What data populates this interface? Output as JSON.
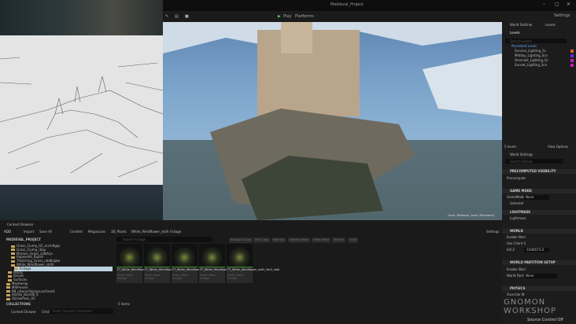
{
  "window": {
    "title": "Medieval_Project",
    "min": "–",
    "max": "□",
    "close": "✕"
  },
  "toolbar": {
    "play": "Play",
    "platforms": "Platforms",
    "settings": "Settings"
  },
  "viewport": {
    "overlay_text": "Level: Medieval_Level (Persistent)"
  },
  "outliner": {
    "tabs": [
      "World Outliner",
      "Levels"
    ],
    "levels_button": "Levels",
    "search_placeholder": "Search Levels",
    "levels": [
      {
        "name": "Persistent Level",
        "color": ""
      },
      {
        "name": "Sunrise_Lighting_Sc",
        "color": "#e06020"
      },
      {
        "name": "Midday_Lighting_Sce",
        "color": "#6a2ae0"
      },
      {
        "name": "Overcast_Lighting_Sc",
        "color": "#c020c0"
      },
      {
        "name": "Sunset_Lighting_Sce",
        "color": "#c020c0"
      }
    ],
    "count": "5 levels",
    "view_options": "View Options"
  },
  "details": {
    "tab": "World Settings",
    "search_placeholder": "Search Details",
    "sections": {
      "precomputed": "PRECOMPUTED VISIBILITY",
      "precompute": "Precompute",
      "game_mode": "GAME MODE",
      "gamemode_label": "GameMode",
      "gamemode_value": "None",
      "selected": "Selected",
      "lightmass": "LIGHTMASS",
      "lightmass_item": "Lightmass",
      "world": "WORLD",
      "enable_world": "Enable Worl",
      "use_client": "Use Client S",
      "kill_z": "Kill Z",
      "kill_z_value": "-1048575.0",
      "partition": "WORLD PARTITION SETUP",
      "enable_wp": "Enable Worl",
      "world_partition": "World Partiti",
      "wp_value": "None",
      "physics": "PHYSICS",
      "override": "Override W"
    },
    "source_control": "Source Control Off"
  },
  "content_browser": {
    "tab": "Content Browser",
    "add": "ADD",
    "import": "Import",
    "save_all": "Save All",
    "breadcrumb": [
      "Content",
      "Megascans",
      "3D_Plants",
      "White_Windflower_sk0h",
      "Foliage"
    ],
    "settings": "Settings",
    "project": "MEDIEVAL_PROJECT",
    "search_placeholder": "Search Foliage",
    "filters": [
      "Blueprint Class",
      "Dim Class",
      "Material",
      "Skeletal Mesh",
      "Static Mesh",
      "Texture",
      "Level"
    ],
    "tree": [
      "Grass_Clump_02_sccm0gqs",
      "Grass_Clump_rbzp",
      "Maroon_Grass_sj4bfcja",
      "Rapeseed_Rapse",
      "Thatching_Grass_uddbrgbw",
      "White_Windflower_sk0h",
      "Foliage",
      "Plants",
      "Decals",
      "Surfaces",
      "Meshwrap",
      "MSPresets",
      "PN_interiorSkyspruceForest",
      "Stylize_Bundle_4",
      "StylizePack_01"
    ],
    "collections": "COLLECTIONS",
    "assets": [
      {
        "name": "FT_White_Windflower_sk0h_Var1_lod0",
        "type": "Static Mesh Foliage"
      },
      {
        "name": "FT_White_Windflower_sk0h_Var2_lod0",
        "type": "Static Mesh Foliage"
      },
      {
        "name": "FT_White_Windflower_sk0h_Var3_lod0",
        "type": "Static Mesh Foliage"
      },
      {
        "name": "FT_White_Windflower_sk0h_Var4_lod0",
        "type": "Static Mesh Foliage"
      },
      {
        "name": "FT_White_Windflower_sk0h_Var5_lod0",
        "type": "Static Mesh Foliage"
      }
    ],
    "item_count": "5 items",
    "drawer": "Content Drawer",
    "cmd": "Cmd",
    "cmd_placeholder": "Enter Console Command"
  },
  "watermark": "GNOMON WORKSHOP"
}
